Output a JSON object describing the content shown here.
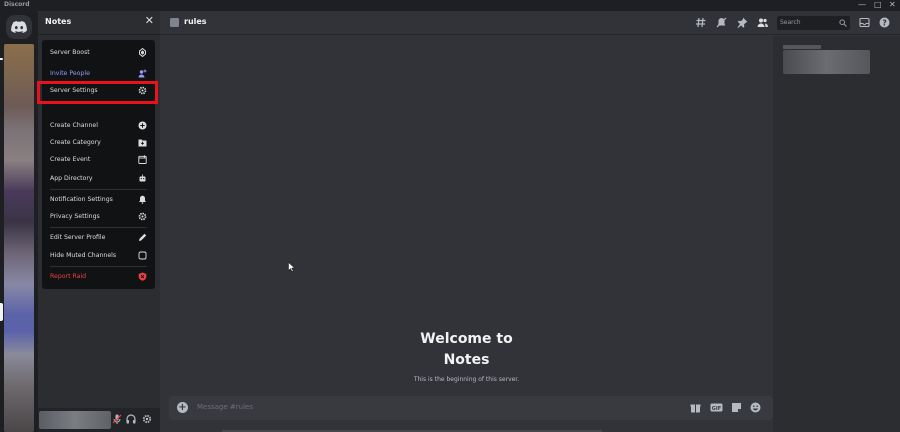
{
  "window": {
    "title": "Discord",
    "controls": {
      "minimize": "—",
      "maximize": "□",
      "close": "✕"
    }
  },
  "rail": {
    "home_icon": "discord-logo-icon"
  },
  "sidebar": {
    "server_name": "Notes",
    "close_symbol": "✕"
  },
  "menu": {
    "items": [
      {
        "label": "Server Boost",
        "icon": "boost-icon"
      },
      {
        "label": "Invite People",
        "icon": "add-user-icon",
        "color": "#949cf7"
      },
      {
        "label": "Server Settings",
        "icon": "gear-icon",
        "highlighted": true
      },
      {
        "label": "Create Channel",
        "icon": "plus-circle-icon"
      },
      {
        "label": "Create Category",
        "icon": "folder-plus-icon"
      },
      {
        "label": "Create Event",
        "icon": "calendar-plus-icon"
      },
      {
        "label": "App Directory",
        "icon": "robot-icon"
      },
      {
        "label": "Notification Settings",
        "icon": "bell-icon"
      },
      {
        "label": "Privacy Settings",
        "icon": "shield-icon"
      },
      {
        "label": "Edit Server Profile",
        "icon": "pencil-icon"
      },
      {
        "label": "Hide Muted Channels",
        "icon": "checkbox-icon"
      },
      {
        "label": "Report Raid",
        "icon": "report-shield-icon",
        "color": "#f23f42"
      }
    ],
    "highlight_color": "#e8121b"
  },
  "channel": {
    "name": "rules",
    "search_placeholder": "Search"
  },
  "header_icons": [
    "threads-icon",
    "notification-mute-icon",
    "pin-icon",
    "members-icon",
    "inbox-icon",
    "help-icon"
  ],
  "chat": {
    "welcome_line1": "Welcome to",
    "welcome_line2": "Notes",
    "welcome_sub": "This is the beginning of this server.",
    "message_placeholder": "Message #rules"
  },
  "composer_icons": [
    "gift-icon",
    "gif-icon",
    "sticker-icon",
    "emoji-icon"
  ],
  "user_panel_icons": [
    "microphone-icon",
    "headphones-icon",
    "gear-icon"
  ],
  "colors": {
    "background": "#313338",
    "sidebar": "#2b2d31",
    "rail": "#1e1f22",
    "menu": "#111214",
    "accent": "#5865f2",
    "danger": "#f23f42"
  }
}
